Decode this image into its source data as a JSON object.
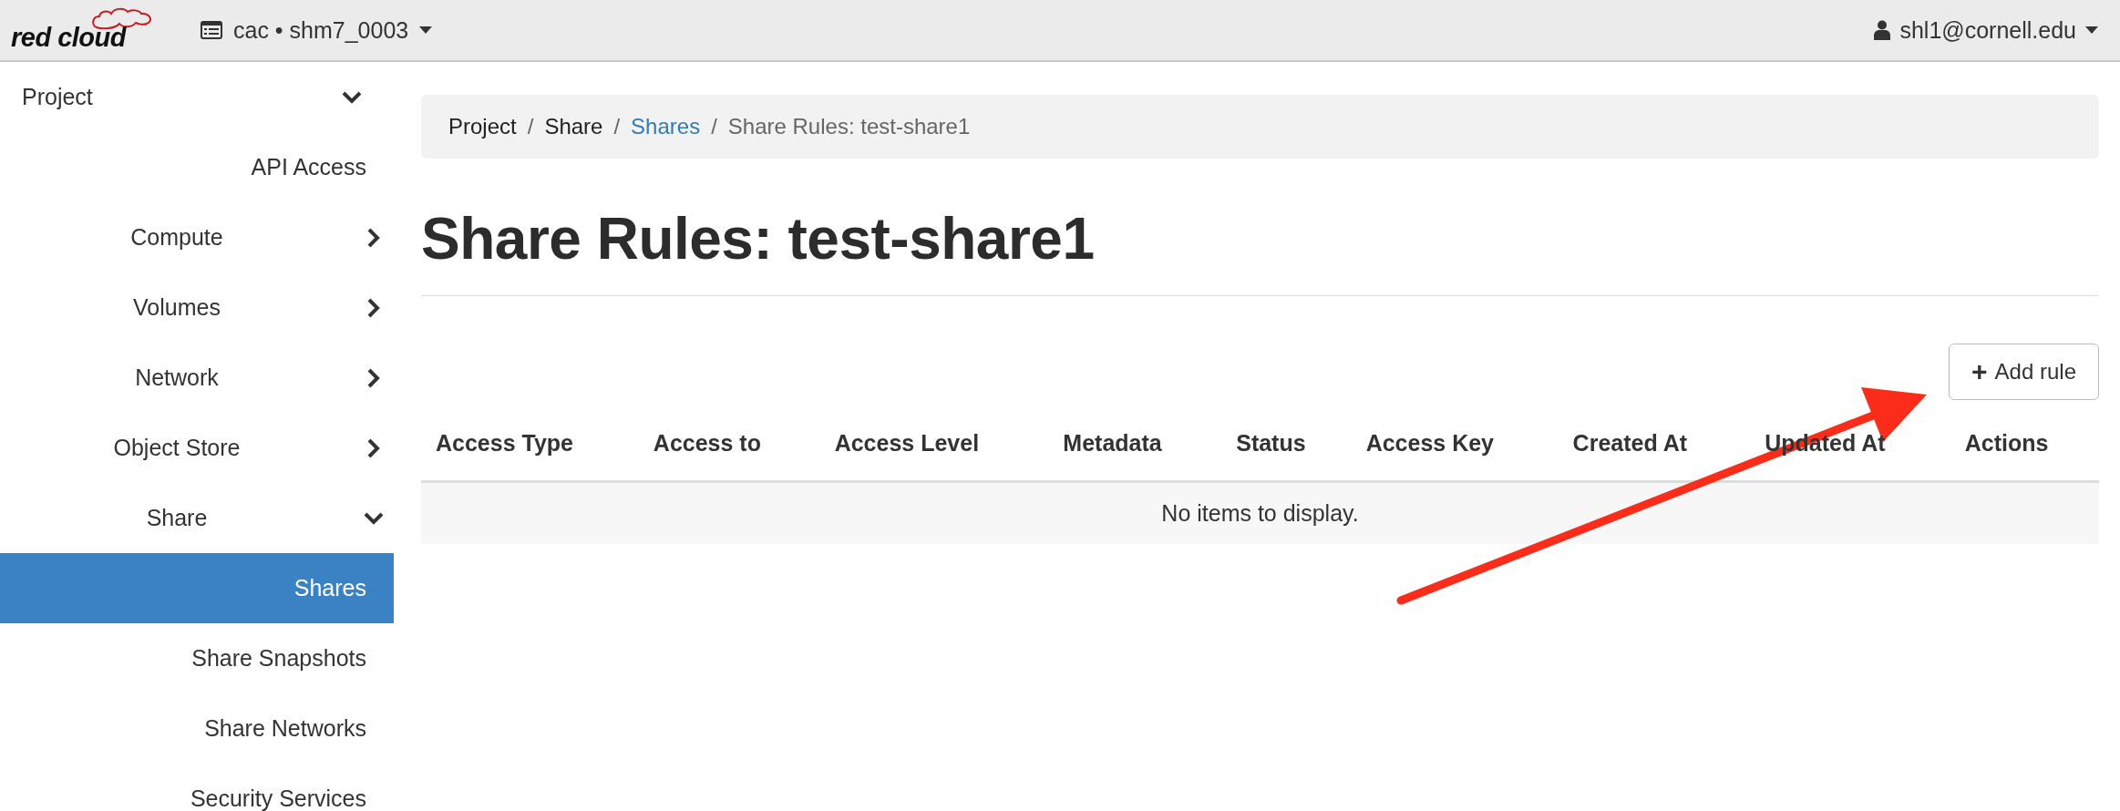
{
  "header": {
    "logo_text": "red cloud",
    "project_switcher": "cac • shm7_0003",
    "user_menu": "shl1@cornell.edu"
  },
  "sidebar": {
    "items": [
      {
        "label": "Project",
        "expanded": true,
        "selected": false,
        "children": [
          {
            "label": "API Access",
            "selected": false
          },
          {
            "label": "Compute",
            "expanded": false,
            "selected": false
          },
          {
            "label": "Volumes",
            "expanded": false,
            "selected": false
          },
          {
            "label": "Network",
            "expanded": false,
            "selected": false
          },
          {
            "label": "Object Store",
            "expanded": false,
            "selected": false
          },
          {
            "label": "Share",
            "expanded": true,
            "selected": false,
            "children": [
              {
                "label": "Shares",
                "selected": true
              },
              {
                "label": "Share Snapshots",
                "selected": false
              },
              {
                "label": "Share Networks",
                "selected": false
              },
              {
                "label": "Security Services",
                "selected": false
              }
            ]
          }
        ]
      }
    ]
  },
  "breadcrumb": [
    {
      "label": "Project",
      "kind": "text",
      "separator": "/"
    },
    {
      "label": "Share",
      "kind": "text",
      "separator": "/"
    },
    {
      "label": "Shares",
      "kind": "link",
      "separator": "/"
    },
    {
      "label": "Share Rules: test-share1",
      "kind": "current"
    }
  ],
  "page_title": "Share Rules: test-share1",
  "add_button": {
    "icon": "+",
    "label": "Add rule"
  },
  "table": {
    "columns": [
      "Access Type",
      "Access to",
      "Access Level",
      "Metadata",
      "Status",
      "Access Key",
      "Created At",
      "Updated At",
      "Actions"
    ],
    "empty_message": "No items to display."
  }
}
